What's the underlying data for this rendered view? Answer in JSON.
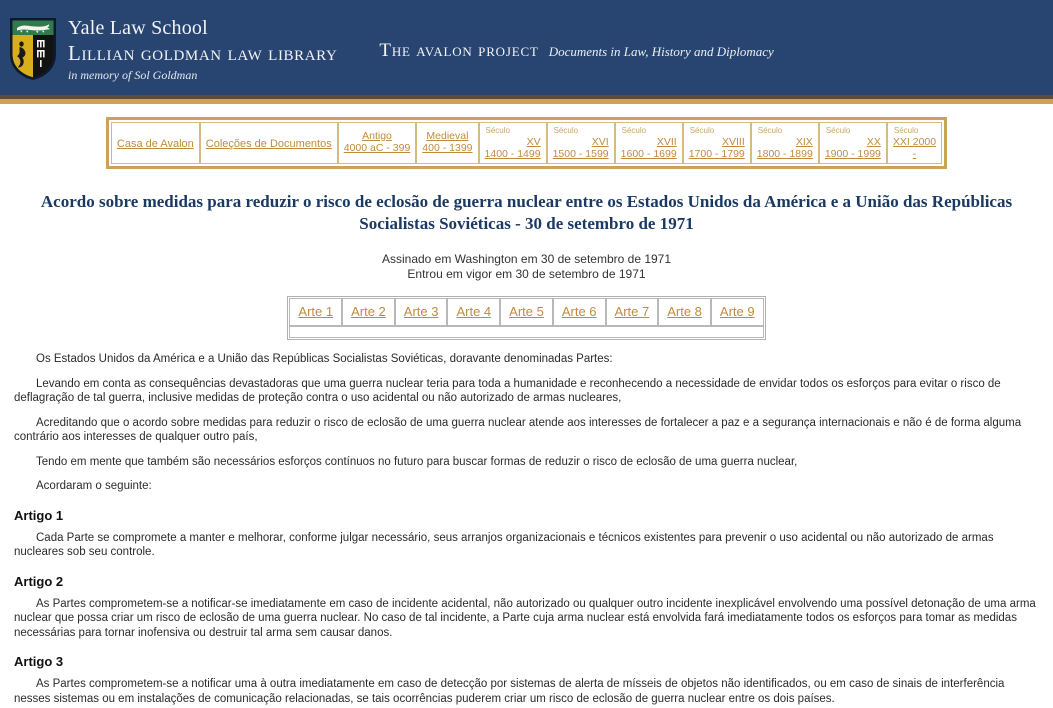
{
  "header": {
    "shield_alt": "yale-shield-icon",
    "brand_line1": "Yale Law School",
    "brand_line2": "Lillian Goldman Law Library",
    "brand_line3": "in memory of Sol Goldman",
    "avalon_title": "The Avalon Project",
    "avalon_subtitle": "Documents in Law, History and Diplomacy",
    "bg_color": "#274570",
    "rule_dark_color": "#5e4b38",
    "rule_gold_color": "#cfa349"
  },
  "nav": {
    "link_color": "#c08b3e",
    "border_color": "#c9a25c",
    "items": [
      {
        "label": "Casa de Avalon",
        "type": "simple"
      },
      {
        "label": "Coleções de Documentos",
        "type": "simple"
      },
      {
        "label": "Antigo",
        "sub": "4000 aC - 399",
        "type": "era"
      },
      {
        "label": "Medieval",
        "sub": "400 - 1399",
        "type": "era"
      },
      {
        "label": "Século",
        "roman": "XV",
        "years": "1400 - 1499",
        "type": "century"
      },
      {
        "label": "Século",
        "roman": "XVI",
        "years": "1500 - 1599",
        "type": "century"
      },
      {
        "label": "Século",
        "roman": "XVII",
        "years": "1600 - 1699",
        "type": "century"
      },
      {
        "label": "Século",
        "roman": "XVIII",
        "years": "1700 - 1799",
        "type": "century"
      },
      {
        "label": "Século",
        "roman": "XIX",
        "years": "1800 - 1899",
        "type": "century"
      },
      {
        "label": "Século",
        "roman": "XX",
        "years": "1900 - 1999",
        "type": "century"
      },
      {
        "label": "Século",
        "roman": "XXI 2000",
        "years": "-",
        "type": "century"
      }
    ]
  },
  "document": {
    "title": "Acordo sobre medidas para reduzir o risco de eclosão de guerra nuclear entre os Estados Unidos da América e a União das Repúblicas Socialistas Soviéticas - 30 de setembro de 1971",
    "signed_line": "Assinado em Washington em 30 de setembro de 1971",
    "effective_line": "Entrou em vigor em 30 de setembro de 1971",
    "title_color": "#1b3a63"
  },
  "article_tabs": [
    {
      "label": "Arte 1"
    },
    {
      "label": "Arte 2"
    },
    {
      "label": "Arte 3"
    },
    {
      "label": "Arte 4"
    },
    {
      "label": "Arte 5"
    },
    {
      "label": "Arte 6"
    },
    {
      "label": "Arte 7"
    },
    {
      "label": "Arte 8"
    },
    {
      "label": "Arte 9"
    }
  ],
  "body": {
    "preamble": [
      "Os Estados Unidos da América e a União das Repúblicas Socialistas Soviéticas, doravante denominadas Partes:",
      "Levando em conta as consequências devastadoras que uma guerra nuclear teria para toda a humanidade e reconhecendo a necessidade de envidar todos os esforços para evitar o risco de deflagração de tal guerra, inclusive medidas de proteção contra o uso acidental ou não autorizado de armas nucleares,",
      "Acreditando que o acordo sobre medidas para reduzir o risco de eclosão de uma guerra nuclear atende aos interesses de fortalecer a paz e a segurança internacionais e não é de forma alguma contrário aos interesses de qualquer outro país,",
      "Tendo em mente que também são necessários esforços contínuos no futuro para buscar formas de reduzir o risco de eclosão de uma guerra nuclear,",
      "Acordaram o seguinte:"
    ],
    "articles": [
      {
        "heading": "Artigo 1",
        "text": "Cada Parte se compromete a manter e melhorar, conforme julgar necessário, seus arranjos organizacionais e técnicos existentes para prevenir o uso acidental ou não autorizado de armas nucleares sob seu controle."
      },
      {
        "heading": "Artigo 2",
        "text": "As Partes comprometem-se a notificar-se imediatamente em caso de incidente acidental, não autorizado ou qualquer outro incidente inexplicável envolvendo uma possível detonação de uma arma nuclear que possa criar um risco de eclosão de uma guerra nuclear. No caso de tal incidente, a Parte cuja arma nuclear está envolvida fará imediatamente todos os esforços para tomar as medidas necessárias para tornar inofensiva ou destruir tal arma sem causar danos."
      },
      {
        "heading": "Artigo 3",
        "text": "As Partes comprometem-se a notificar uma à outra imediatamente em caso de detecção por sistemas de alerta de mísseis de objetos não identificados, ou em caso de sinais de interferência nesses sistemas ou em instalações de comunicação relacionadas, se tais ocorrências puderem criar um risco de eclosão de guerra nuclear entre os dois países."
      }
    ]
  }
}
